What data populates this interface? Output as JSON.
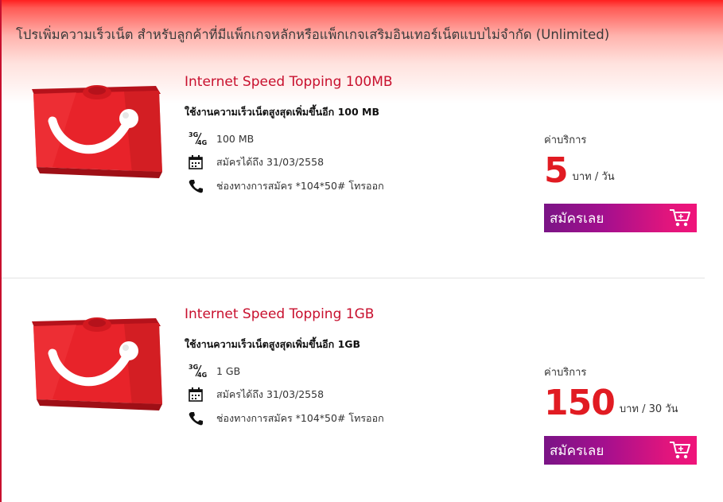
{
  "header": {
    "title": "โปรเพิ่มความเร็วเน็ต สำหรับลูกค้าที่มีแพ็กเกจหลักหรือแพ็กเกจเสริมอินเทอร์เน็ตแบบไม่จำกัด (Unlimited)"
  },
  "packages": [
    {
      "name": "Internet Speed Topping 100MB",
      "description": "ใช้งานความเร็วเน็ตสูงสุดเพิ่มขึ้นอีก 100 MB",
      "features": {
        "network_icon": "3g-4g-icon",
        "data": "100 MB",
        "calendar_icon": "calendar-icon",
        "valid_until": "สมัครได้ถึง 31/03/2558",
        "phone_icon": "phone-icon",
        "channel": "ช่องทางการสมัคร *104*50# โทรออก"
      },
      "price_label": "ค่าบริการ",
      "price": "5",
      "price_unit": "บาท / วัน",
      "signup_label": "สมัครเลย",
      "cart_icon": "cart-icon"
    },
    {
      "name": "Internet Speed Topping 1GB",
      "description": "ใช้งานความเร็วเน็ตสูงสุดเพิ่มขึ้นอีก 1GB",
      "features": {
        "network_icon": "3g-4g-icon",
        "data": "1 GB",
        "calendar_icon": "calendar-icon",
        "valid_until": "สมัครได้ถึง 31/03/2558",
        "phone_icon": "phone-icon",
        "channel": "ช่องทางการสมัคร *104*50# โทรออก"
      },
      "price_label": "ค่าบริการ",
      "price": "150",
      "price_unit": "บาท / 30 วัน",
      "signup_label": "สมัครเลย",
      "cart_icon": "cart-icon"
    }
  ],
  "colors": {
    "brand_red": "#e11b22",
    "title_red": "#c8102e",
    "button_purple": "#7a1486",
    "button_pink": "#f0147a"
  }
}
